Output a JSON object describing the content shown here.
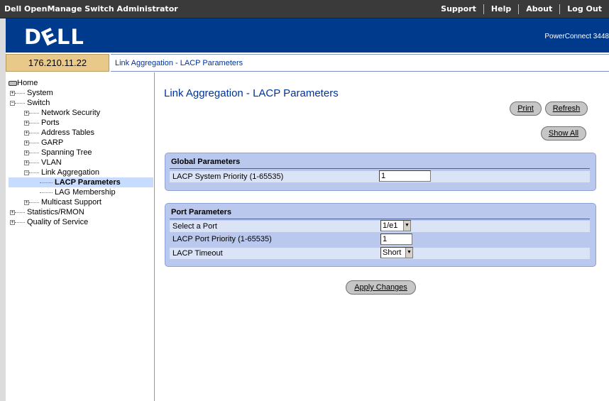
{
  "top_menu": {
    "title": "Dell OpenManage Switch Administrator",
    "items": [
      "Support",
      "Help",
      "About",
      "Log Out"
    ]
  },
  "brand": {
    "logo": "DELL",
    "model": "PowerConnect 3448"
  },
  "address": {
    "ip": "176.210.11.22",
    "breadcrumb": "Link Aggregation - LACP Parameters"
  },
  "tree": [
    {
      "label": "Home"
    },
    {
      "label": "System"
    },
    {
      "label": "Switch"
    },
    {
      "label": "Network Security"
    },
    {
      "label": "Ports"
    },
    {
      "label": "Address Tables"
    },
    {
      "label": "GARP"
    },
    {
      "label": "Spanning Tree"
    },
    {
      "label": "VLAN"
    },
    {
      "label": "Link Aggregation"
    },
    {
      "label": "LACP Parameters"
    },
    {
      "label": "LAG Membership"
    },
    {
      "label": "Multicast Support"
    },
    {
      "label": "Statistics/RMON"
    },
    {
      "label": "Quality of Service"
    }
  ],
  "page": {
    "title": "Link Aggregation - LACP Parameters",
    "buttons": {
      "print": "Print",
      "refresh": "Refresh",
      "show_all": "Show All",
      "apply": "Apply Changes"
    },
    "global": {
      "header": "Global Parameters",
      "system_priority_label": "LACP System Priority (1-65535)",
      "system_priority_value": "1"
    },
    "port": {
      "header": "Port Parameters",
      "select_port_label": "Select a Port",
      "select_port_value": "1/e1",
      "port_priority_label": "LACP Port Priority (1-65535)",
      "port_priority_value": "1",
      "timeout_label": "LACP Timeout",
      "timeout_value": "Short"
    }
  },
  "colors": {
    "brand_blue": "#003a8c",
    "panel": "#b9c8ec",
    "link": "#003399",
    "ip_cell": "#e9c98a"
  }
}
